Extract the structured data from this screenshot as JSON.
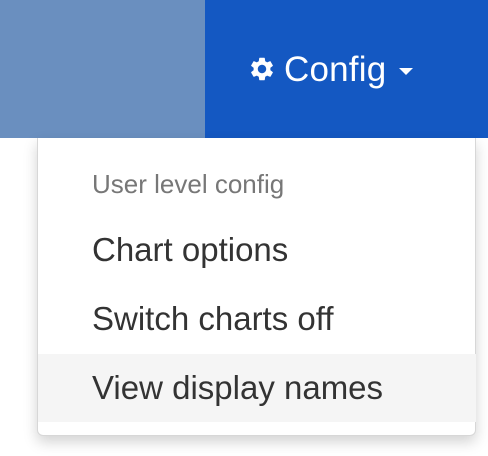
{
  "navbar": {
    "config_label": "Config",
    "config_icon": "gear-icon",
    "caret_icon": "caret-down-icon",
    "colors": {
      "navbar_bg": "#6a8fbf",
      "config_bg": "#1458c2",
      "text_on_nav": "#ffffff"
    }
  },
  "dropdown": {
    "header": "User level config",
    "items": [
      {
        "label": "Chart options"
      },
      {
        "label": "Switch charts off"
      },
      {
        "label": "View display names",
        "hovered": true
      }
    ],
    "colors": {
      "header_text": "#777777",
      "item_text": "#333333",
      "hover_bg": "#f5f5f5"
    }
  }
}
